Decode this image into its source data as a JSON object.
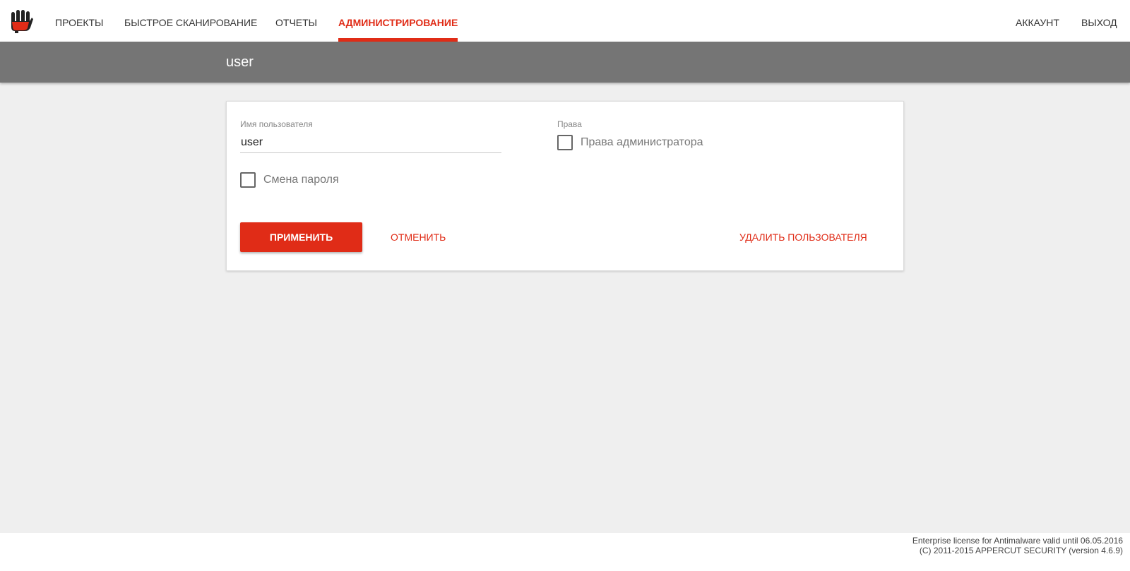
{
  "logo": {
    "icon": "hand-logo-icon",
    "colors": [
      "#222222",
      "#e02c17"
    ]
  },
  "nav": {
    "items": [
      {
        "label": "ПРОЕКТЫ",
        "active": false
      },
      {
        "label": "БЫСТРОЕ СКАНИРОВАНИЕ",
        "active": false
      },
      {
        "label": "ОТЧЕТЫ",
        "active": false
      },
      {
        "label": "АДМИНИСТРИРОВАНИЕ",
        "active": true
      }
    ],
    "right": [
      {
        "label": "АККАУНТ"
      },
      {
        "label": "ВЫХОД"
      }
    ]
  },
  "page": {
    "title": "user"
  },
  "form": {
    "username_label": "Имя пользователя",
    "username_value": "user",
    "change_password_label": "Смена пароля",
    "change_password_checked": false,
    "rights_label": "Права",
    "admin_rights_label": "Права администратора",
    "admin_rights_checked": false,
    "apply_label": "ПРИМЕНИТЬ",
    "cancel_label": "ОТМЕНИТЬ",
    "delete_label": "УДАЛИТЬ ПОЛЬЗОВАТЕЛЯ"
  },
  "footer": {
    "license": "Enterprise license for Antimalware valid until 06.05.2016",
    "copyright": "(C) 2011-2015 APPERCUT SECURITY (version 4.6.9)"
  },
  "colors": {
    "accent": "#e02c17",
    "header_bg": "#757575",
    "page_bg": "#efefef"
  }
}
